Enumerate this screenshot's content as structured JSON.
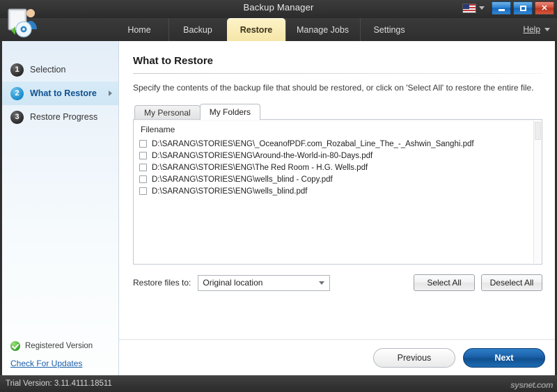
{
  "window": {
    "title": "Backup Manager",
    "language_icon": "us-flag-icon",
    "minimize_label": "",
    "maximize_label": "",
    "close_label": "✕"
  },
  "header": {
    "app_icon": "backup-manager-app-icon",
    "tabs": [
      {
        "label": "Home",
        "active": false
      },
      {
        "label": "Backup",
        "active": false
      },
      {
        "label": "Restore",
        "active": true
      },
      {
        "label": "Manage Jobs",
        "active": false
      },
      {
        "label": "Settings",
        "active": false
      }
    ],
    "help_label": "Help"
  },
  "sidebar": {
    "steps": [
      {
        "number": "1",
        "label": "Selection",
        "active": false
      },
      {
        "number": "2",
        "label": "What to Restore",
        "active": true
      },
      {
        "number": "3",
        "label": "Restore Progress",
        "active": false
      }
    ],
    "registered_label": "Registered Version",
    "updates_link": "Check For Updates"
  },
  "main": {
    "page_title": "What to Restore",
    "description": "Specify the contents of the backup file that should be restored, or click on 'Select All' to restore the entire file.",
    "tabs": [
      {
        "label": "My Personal",
        "active": false
      },
      {
        "label": "My Folders",
        "active": true
      }
    ],
    "list": {
      "column_header": "Filename",
      "rows": [
        {
          "checked": false,
          "filename": "D:\\SARANG\\STORIES\\ENG\\_OceanofPDF.com_Rozabal_Line_The_-_Ashwin_Sanghi.pdf"
        },
        {
          "checked": false,
          "filename": "D:\\SARANG\\STORIES\\ENG\\Around-the-World-in-80-Days.pdf"
        },
        {
          "checked": false,
          "filename": "D:\\SARANG\\STORIES\\ENG\\The Red Room - H.G. Wells.pdf"
        },
        {
          "checked": false,
          "filename": "D:\\SARANG\\STORIES\\ENG\\wells_blind - Copy.pdf"
        },
        {
          "checked": false,
          "filename": "D:\\SARANG\\STORIES\\ENG\\wells_blind.pdf"
        }
      ]
    },
    "restore_to_label": "Restore files to:",
    "restore_to_value": "Original location",
    "restore_to_options": [
      "Original location"
    ],
    "select_all_label": "Select All",
    "deselect_all_label": "Deselect All",
    "previous_label": "Previous",
    "next_label": "Next"
  },
  "status": {
    "trial_text": "Trial Version: 3.11.4111.18511",
    "watermark": "sysnet.com"
  },
  "colors": {
    "accent_blue": "#1a5fa8",
    "active_tab_cream": "#f6e6a8",
    "step_active_blue": "#10508f",
    "registered_green": "#2e9b27"
  }
}
